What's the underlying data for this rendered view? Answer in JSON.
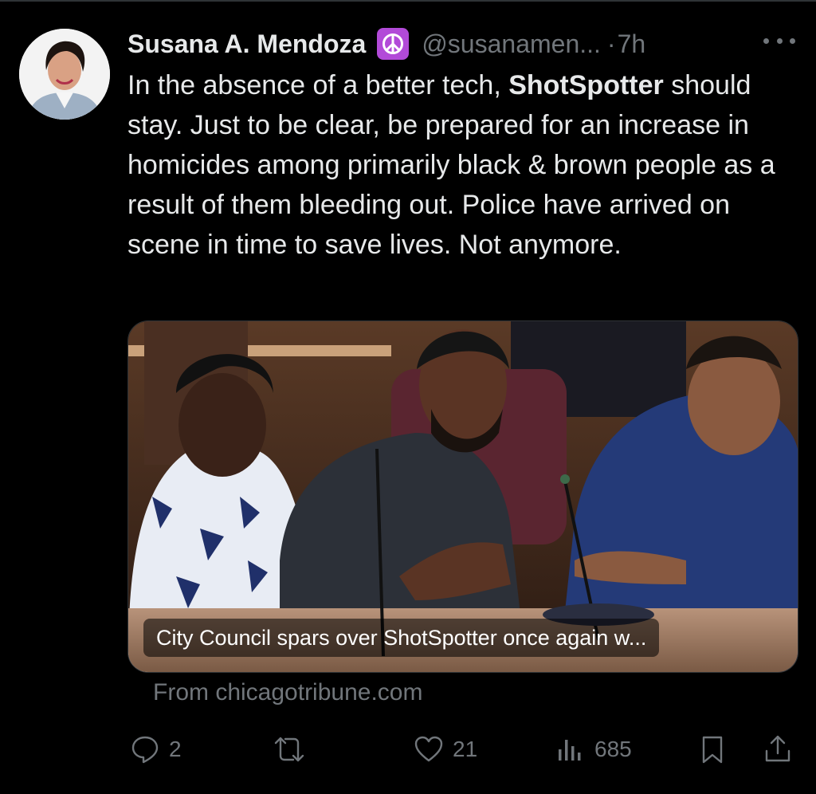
{
  "tweet": {
    "author_name": "Susana A. Mendoza",
    "badge_emoji": "☮",
    "handle": "@susanamen...",
    "separator": "·",
    "time": "7h",
    "text_part1": "In the absence of a better tech, ",
    "text_bold": "ShotSpotter",
    "text_part2": " should stay. Just to be clear, be prepared for an increase in homicides among primarily black & brown people as a result of them bleeding out. Police have arrived on scene in time to save lives. Not anymore."
  },
  "card": {
    "headline": "City Council spars over ShotSpotter once again w...",
    "source": "From chicagotribune.com"
  },
  "actions": {
    "replies": "2",
    "reposts": "",
    "likes": "21",
    "views": "685"
  },
  "icons": {
    "avatar": "avatar-image",
    "badge": "peace-emoji",
    "more": "more-icon",
    "reply": "reply-icon",
    "repost": "repost-icon",
    "like": "heart-icon",
    "views": "views-icon",
    "bookmark": "bookmark-icon",
    "share": "share-icon"
  },
  "colors": {
    "background": "#000000",
    "text": "#e7e9ea",
    "muted": "#71767b",
    "badge": "#b24ad8"
  }
}
